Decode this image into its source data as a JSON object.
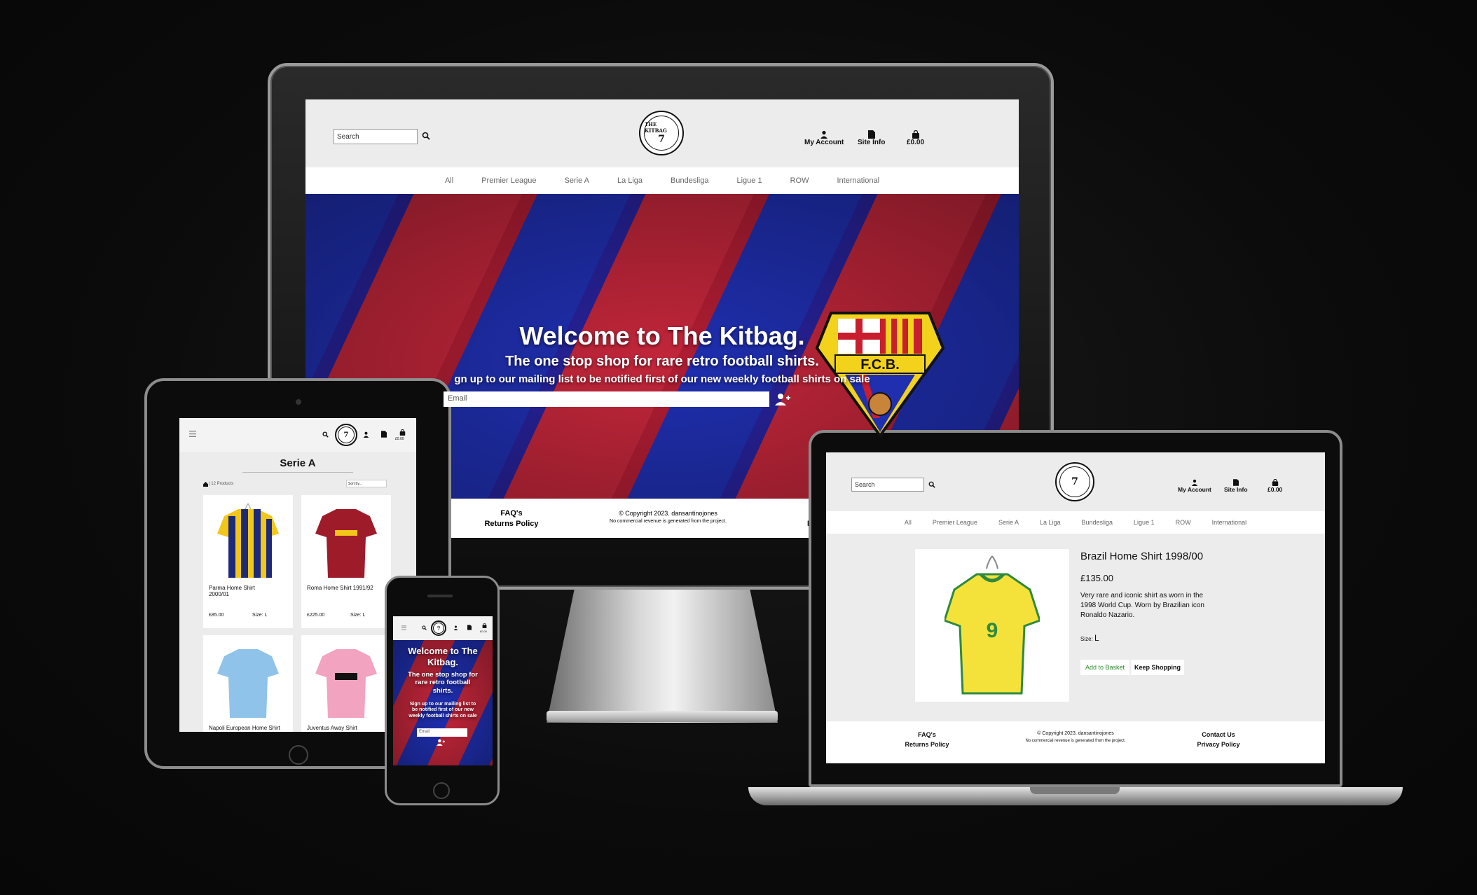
{
  "desktop": {
    "search_placeholder": "Search",
    "header": {
      "account": "My Account",
      "site_info": "Site Info",
      "basket": "£0.00"
    },
    "logo_text": "THE KITBAG",
    "nav": [
      "All",
      "Premier League",
      "Serie A",
      "La Liga",
      "Bundesliga",
      "Ligue 1",
      "ROW",
      "International"
    ],
    "hero": {
      "title": "Welcome to The Kitbag.",
      "subtitle": "The one stop shop for rare retro football shirts.",
      "signup": "gn up to our mailing list to be notified first of our new weekly football shirts on sale",
      "email_placeholder": "Email"
    },
    "crest_text": "F.C.B.",
    "footer": {
      "faq": "FAQ's",
      "returns": "Returns Policy",
      "copyright": "© Copyright 2023. dansantinojones",
      "note": "No commercial revenue is generated from the project.",
      "right_partial": "P"
    }
  },
  "tablet": {
    "basket": "£0.00",
    "page_title": "Serie A",
    "count": "12 Products",
    "sort": "Sort by...",
    "products": [
      {
        "name": "Parma Home Shirt 2000/01",
        "price": "£85.00",
        "size": "Size: L"
      },
      {
        "name": "Roma Home Shirt 1991/92",
        "price": "£225.00",
        "size": "Size: L"
      },
      {
        "name": "Napoli European Home Shirt",
        "price": "",
        "size": ""
      },
      {
        "name": "Juventus Away Shirt",
        "price": "",
        "size": ""
      }
    ]
  },
  "phone": {
    "basket": "£0.00",
    "title": "Welcome to The Kitbag.",
    "subtitle": "The one stop shop for rare retro football shirts.",
    "signup": "Sign up to our mailing list to be notified first of our new weekly football shirts on sale",
    "email_placeholder": "Email"
  },
  "laptop": {
    "search_placeholder": "Search",
    "header": {
      "account": "My Account",
      "site_info": "Site Info",
      "basket": "£0.00"
    },
    "nav": [
      "All",
      "Premier League",
      "Serie A",
      "La Liga",
      "Bundesliga",
      "Ligue 1",
      "ROW",
      "International"
    ],
    "product": {
      "name": "Brazil Home Shirt 1998/00",
      "price": "£135.00",
      "description": "Very rare and iconic shirt as worn in the 1998 World Cup. Worn by Brazilian icon Ronaldo Nazario.",
      "size_label": "Size:",
      "size_value": "L",
      "add_button": "Add to Basket",
      "keep_button": "Keep Shopping"
    },
    "footer": {
      "faq": "FAQ's",
      "returns": "Returns Policy",
      "copyright": "© Copyright 2023. dansantinojones",
      "note": "No commercial revenue is generated from the project.",
      "contact": "Contact Us",
      "privacy": "Privacy Policy"
    }
  },
  "colors": {
    "background": "#0b0b0b",
    "hero_blue": "#1f2fb0",
    "hero_red": "#c2263a",
    "basket_green": "#2a8a2a"
  },
  "icons": [
    "search-icon",
    "user-icon",
    "document-icon",
    "bag-icon",
    "add-user-icon",
    "home-icon",
    "hamburger-icon"
  ]
}
